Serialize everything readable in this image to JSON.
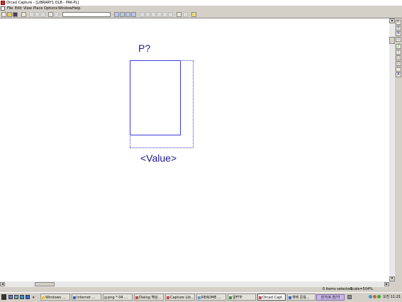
{
  "titlebar": {
    "title": "Orcad Capture - [LIBRARY1.OLB - PAK-PL]"
  },
  "menu": {
    "items": [
      "File",
      "Edit",
      "View",
      "Place",
      "Options",
      "Window",
      "Help"
    ]
  },
  "part": {
    "reference": "P?",
    "value": "<Value>"
  },
  "status": {
    "selection": "0 items selected",
    "scale": "Scale=504%"
  },
  "taskbar": {
    "tasks": [
      "Windows ...",
      "Internet ...",
      "png * 04 ...",
      "Dialog 해상...",
      "Capture Lib...",
      "README ...",
      "알FTP",
      "Orcad Capt...",
      "재택 문용..."
    ],
    "ime": "한가/A 한/가",
    "clock": "오전 11:21"
  },
  "icons": {
    "toolbar": [
      "new-icon",
      "open-icon",
      "save-icon",
      "print-icon",
      "cut-icon",
      "copy-icon",
      "paste-icon",
      "undo-icon",
      "redo-icon",
      "zoom-in-icon",
      "zoom-out-icon",
      "zoom-area-icon",
      "zoom-all-icon",
      "help-icon"
    ],
    "palette": [
      "select-icon",
      "place-pin-icon",
      "pin-array-icon",
      "ieee-symbol-icon",
      "line-icon",
      "polyline-icon",
      "rectangle-icon",
      "ellipse-icon",
      "arc-icon",
      "text-icon"
    ]
  },
  "colors": {
    "part_outline": "#3b3be0",
    "part_text": "#1a1a8c"
  }
}
